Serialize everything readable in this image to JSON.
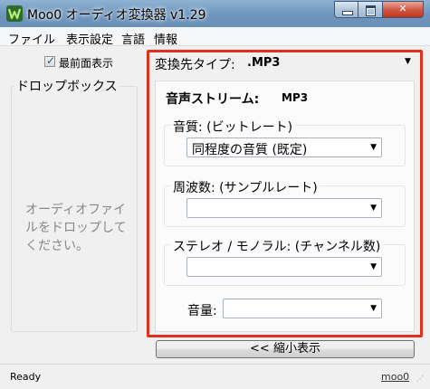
{
  "window": {
    "title": "Moo0 オーディオ変換器 v1.29"
  },
  "menu": [
    {
      "label": "ファイル"
    },
    {
      "label": "表示設定"
    },
    {
      "label": "言語"
    },
    {
      "label": "情報"
    }
  ],
  "left": {
    "always_on_top_label": "最前面表示",
    "always_on_top_checked": true,
    "drop_group_title": "ドロップボックス",
    "drop_hint": "オーディオファイルをドロップしてください。"
  },
  "right": {
    "output_type_label": "変換先タイプ:",
    "output_type_value": ".MP3",
    "stream_label": "音声ストリーム:",
    "stream_format": "MP3",
    "quality_label": "音質: (ビットレート)",
    "quality_value": "同程度の音質 (既定)",
    "frequency_label": "周波数: (サンプルレート)",
    "frequency_value": "",
    "channels_label": "ステレオ / モノラル: (チャンネル数)",
    "channels_value": "",
    "volume_label": "音量:",
    "volume_value": ""
  },
  "compact_button_label": "<< 縮小表示",
  "status": {
    "text": "Ready",
    "brand": "moo0"
  },
  "colors": {
    "highlight_frame": "#e0301e",
    "titlebar": "#6f95bd"
  },
  "icons": {
    "app": "moo0-leaf-icon",
    "minimize": "minimize-icon",
    "maximize": "maximize-icon",
    "close": "close-icon",
    "dropdown": "chevron-down-icon"
  }
}
